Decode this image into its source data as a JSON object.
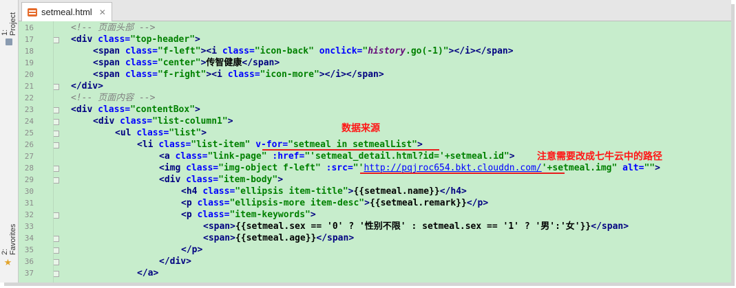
{
  "sidebar": {
    "project_label": "1: Project",
    "favorites_label": "2: Favorites"
  },
  "tab": {
    "filename": "setmeal.html",
    "icon": "html-file-icon"
  },
  "lines": [
    {
      "n": "16",
      "tokens": [
        [
          "cm",
          "<!-- 页面头部 -->"
        ]
      ]
    },
    {
      "n": "17",
      "tokens": [
        [
          "tg",
          "<div "
        ],
        [
          "at",
          "class="
        ],
        [
          "st",
          "\"top-header\""
        ],
        [
          "tg",
          ">"
        ]
      ]
    },
    {
      "n": "18",
      "tokens": [
        [
          "tg",
          "<span "
        ],
        [
          "at",
          "class="
        ],
        [
          "st",
          "\"f-left\""
        ],
        [
          "tg",
          "><i "
        ],
        [
          "at",
          "class="
        ],
        [
          "st",
          "\"icon-back\" "
        ],
        [
          "at",
          "onclick="
        ],
        [
          "st",
          "\""
        ],
        [
          "jsv",
          "history"
        ],
        [
          "st",
          ".go(-1)\""
        ],
        [
          "tg",
          "></i></span>"
        ]
      ]
    },
    {
      "n": "19",
      "tokens": [
        [
          "tg",
          "<span "
        ],
        [
          "at",
          "class="
        ],
        [
          "st",
          "\"center\""
        ],
        [
          "tg",
          ">"
        ],
        [
          "tx",
          "传智健康"
        ],
        [
          "tg",
          "</span>"
        ]
      ]
    },
    {
      "n": "20",
      "tokens": [
        [
          "tg",
          "<span "
        ],
        [
          "at",
          "class="
        ],
        [
          "st",
          "\"f-right\""
        ],
        [
          "tg",
          "><i "
        ],
        [
          "at",
          "class="
        ],
        [
          "st",
          "\"icon-more\""
        ],
        [
          "tg",
          "></i></span>"
        ]
      ]
    },
    {
      "n": "21",
      "tokens": [
        [
          "tg",
          "</div>"
        ]
      ]
    },
    {
      "n": "22",
      "tokens": [
        [
          "cm",
          "<!-- 页面内容 -->"
        ]
      ]
    },
    {
      "n": "23",
      "tokens": [
        [
          "tg",
          "<div "
        ],
        [
          "at",
          "class="
        ],
        [
          "st",
          "\"contentBox\""
        ],
        [
          "tg",
          ">"
        ]
      ]
    },
    {
      "n": "24",
      "tokens": [
        [
          "tg",
          "<div "
        ],
        [
          "at",
          "class="
        ],
        [
          "st",
          "\"list-column1\""
        ],
        [
          "tg",
          ">"
        ]
      ]
    },
    {
      "n": "25",
      "tokens": [
        [
          "tg",
          "<ul "
        ],
        [
          "at",
          "class="
        ],
        [
          "st",
          "\"list\""
        ],
        [
          "tg",
          ">"
        ]
      ]
    },
    {
      "n": "26",
      "tokens": [
        [
          "tg",
          "<li "
        ],
        [
          "at",
          "class="
        ],
        [
          "st",
          "\"list-item\" "
        ],
        [
          "at",
          "v-for="
        ],
        [
          "st",
          "\"setmeal in setmealList\""
        ],
        [
          "tg",
          ">"
        ]
      ]
    },
    {
      "n": "27",
      "tokens": [
        [
          "tg",
          "<a "
        ],
        [
          "at",
          "class="
        ],
        [
          "st",
          "\"link-page\" "
        ],
        [
          "at",
          ":href="
        ],
        [
          "st",
          "\"'setmeal_detail.html?id='+setmeal.id\""
        ],
        [
          "tg",
          ">"
        ]
      ]
    },
    {
      "n": "28",
      "tokens": [
        [
          "tg",
          "<img "
        ],
        [
          "at",
          "class="
        ],
        [
          "st",
          "\"img-object f-left\" "
        ],
        [
          "at",
          ":src="
        ],
        [
          "st",
          "\"'"
        ],
        [
          "ul",
          "http://pqjroc654.bkt.clouddn.com/"
        ],
        [
          "st",
          "'+setmeal.img\" "
        ],
        [
          "at",
          "alt="
        ],
        [
          "st",
          "\"\""
        ],
        [
          "tg",
          ">"
        ]
      ]
    },
    {
      "n": "29",
      "tokens": [
        [
          "tg",
          "<div "
        ],
        [
          "at",
          "class="
        ],
        [
          "st",
          "\"item-body\""
        ],
        [
          "tg",
          ">"
        ]
      ]
    },
    {
      "n": "30",
      "tokens": [
        [
          "tg",
          "<h4 "
        ],
        [
          "at",
          "class="
        ],
        [
          "st",
          "\"ellipsis item-title\""
        ],
        [
          "tg",
          ">"
        ],
        [
          "tx",
          "{{setmeal.name}}"
        ],
        [
          "tg",
          "</h4>"
        ]
      ]
    },
    {
      "n": "31",
      "tokens": [
        [
          "tg",
          "<p "
        ],
        [
          "at",
          "class="
        ],
        [
          "st",
          "\"ellipsis-more item-desc\""
        ],
        [
          "tg",
          ">"
        ],
        [
          "tx",
          "{{setmeal.remark}}"
        ],
        [
          "tg",
          "</p>"
        ]
      ]
    },
    {
      "n": "32",
      "tokens": [
        [
          "tg",
          "<p "
        ],
        [
          "at",
          "class="
        ],
        [
          "st",
          "\"item-keywords\""
        ],
        [
          "tg",
          ">"
        ]
      ]
    },
    {
      "n": "33",
      "tokens": [
        [
          "tg",
          "<span>"
        ],
        [
          "tx",
          "{{setmeal.sex == '0' ? '性别不限' : setmeal.sex == '1' ? '男':'女'}}"
        ],
        [
          "tg",
          "</span>"
        ]
      ]
    },
    {
      "n": "34",
      "tokens": [
        [
          "tg",
          "<span>"
        ],
        [
          "tx",
          "{{setmeal.age}}"
        ],
        [
          "tg",
          "</span>"
        ]
      ]
    },
    {
      "n": "35",
      "tokens": [
        [
          "tg",
          "</p>"
        ]
      ]
    },
    {
      "n": "36",
      "tokens": [
        [
          "tg",
          "</div>"
        ]
      ]
    },
    {
      "n": "37",
      "tokens": [
        [
          "tg",
          "</a>"
        ]
      ]
    }
  ],
  "annotations": {
    "data_source": "数据来源",
    "change_path": "注意需要改成七牛云中的路径"
  },
  "colors": {
    "editor_bg": "#c7edcc",
    "tag": "#000080",
    "attribute": "#0000ff",
    "string": "#008000",
    "comment": "#808080",
    "annotation": "#ff1515"
  }
}
